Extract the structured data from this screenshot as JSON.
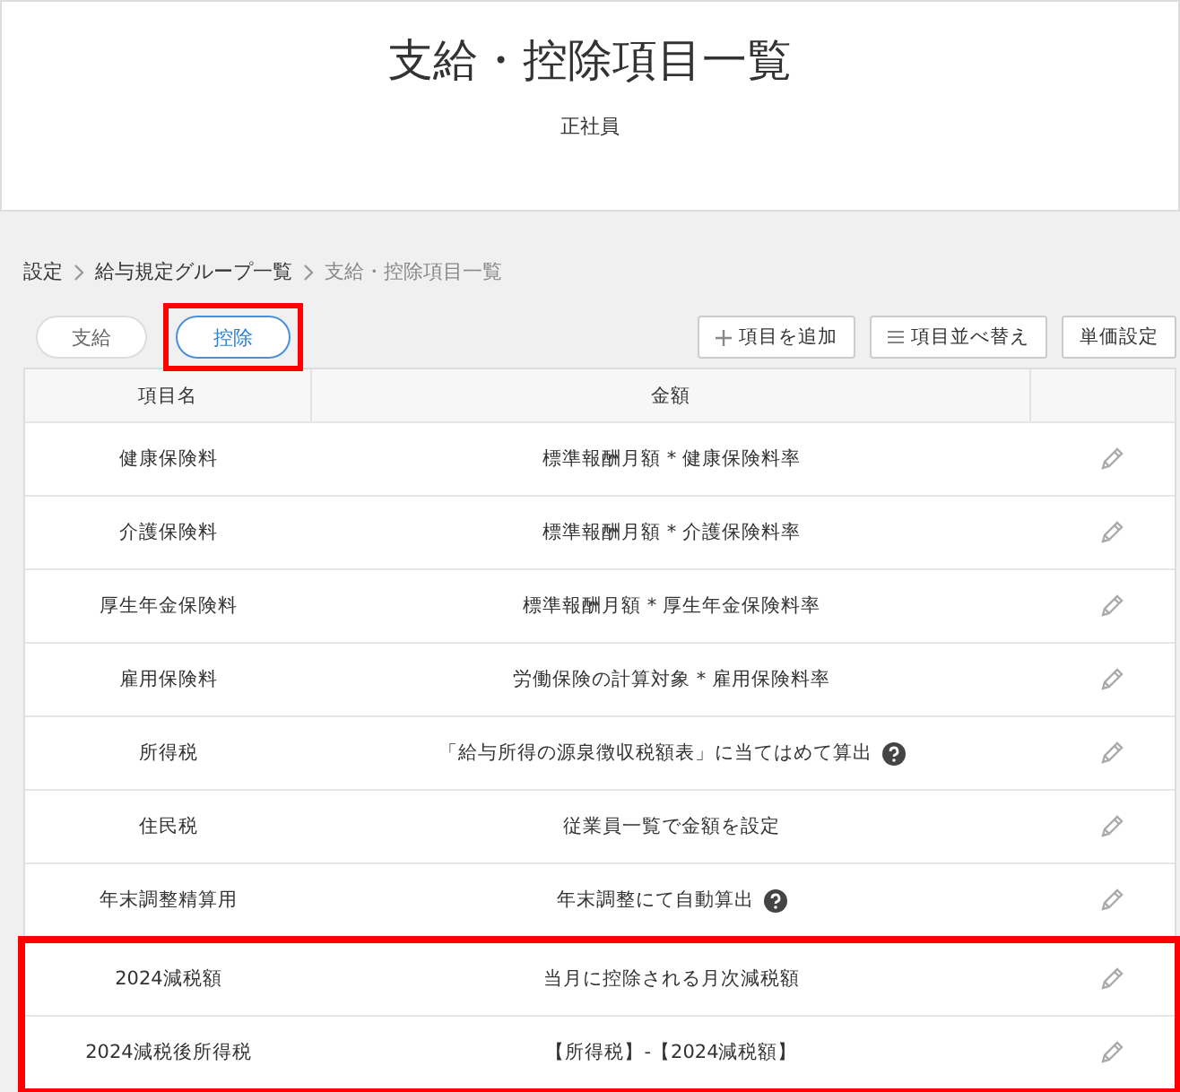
{
  "header": {
    "title": "支給・控除項目一覧",
    "subtitle": "正社員"
  },
  "breadcrumb": [
    {
      "label": "設定",
      "link": true
    },
    {
      "label": "給与規定グループ一覧",
      "link": true
    },
    {
      "label": "支給・控除項目一覧",
      "link": false
    }
  ],
  "tabs": [
    {
      "label": "支給",
      "selected": false,
      "highlighted": false
    },
    {
      "label": "控除",
      "selected": true,
      "highlighted": true
    }
  ],
  "buttons": [
    {
      "label": "項目を追加",
      "kind": "add"
    },
    {
      "label": "項目並べ替え",
      "kind": "sort"
    },
    {
      "label": "単価設定",
      "kind": "plain"
    }
  ],
  "table": {
    "columns": [
      "項目名",
      "金額"
    ],
    "rows": [
      {
        "name": "健康保険料",
        "amount": "標準報酬月額 * 健康保険料率",
        "help": false,
        "highlighted": false
      },
      {
        "name": "介護保険料",
        "amount": "標準報酬月額 * 介護保険料率",
        "help": false,
        "highlighted": false
      },
      {
        "name": "厚生年金保険料",
        "amount": "標準報酬月額 * 厚生年金保険料率",
        "help": false,
        "highlighted": false
      },
      {
        "name": "雇用保険料",
        "amount": "労働保険の計算対象 * 雇用保険料率",
        "help": false,
        "highlighted": false
      },
      {
        "name": "所得税",
        "amount": "「給与所得の源泉徴収税額表」に当てはめて算出",
        "help": true,
        "highlighted": false
      },
      {
        "name": "住民税",
        "amount": "従業員一覧で金額を設定",
        "help": false,
        "highlighted": false
      },
      {
        "name": "年末調整精算用",
        "amount": "年末調整にて自動算出",
        "help": true,
        "highlighted": false
      },
      {
        "name": "2024減税額",
        "amount": "当月に控除される月次減税額",
        "help": false,
        "highlighted": true
      },
      {
        "name": "2024減税後所得税",
        "amount": "【所得税】-【2024減税額】",
        "help": false,
        "highlighted": true
      }
    ]
  }
}
